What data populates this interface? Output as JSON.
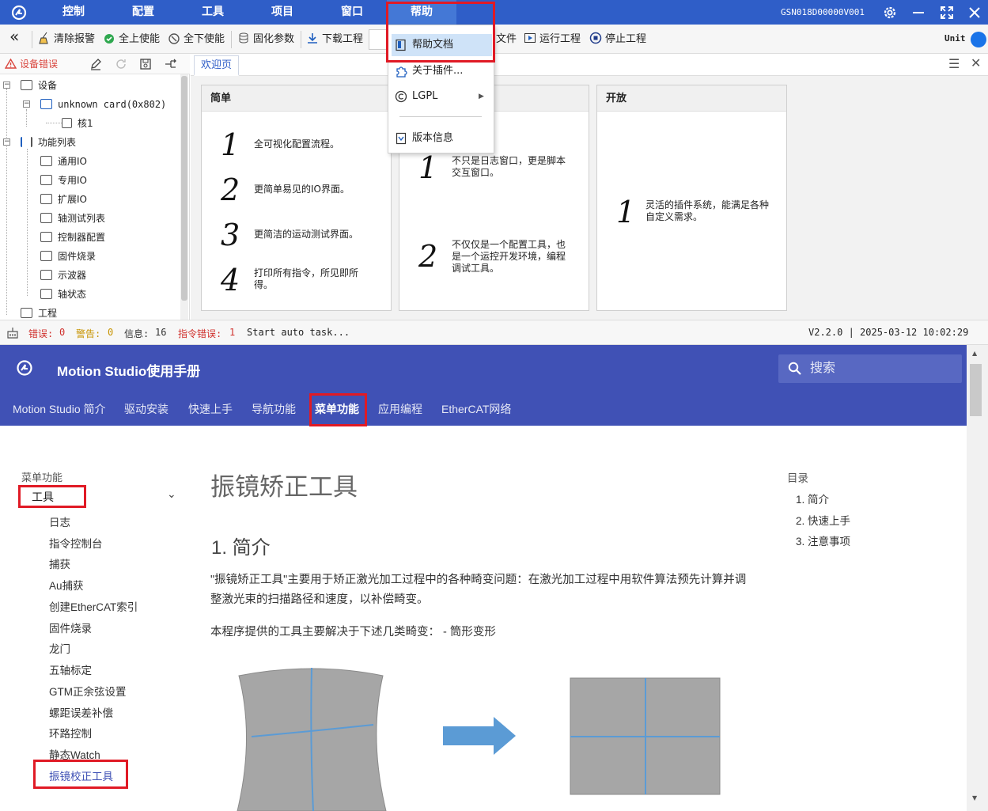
{
  "menubar": {
    "items": [
      "控制",
      "配置",
      "工具",
      "项目",
      "窗口",
      "帮助"
    ],
    "device_id": "GSN018D00000V001",
    "colors": {
      "bar": "#2f5ec8",
      "active": "#4478d6"
    }
  },
  "toolbar": {
    "items": [
      "清除报警",
      "全上使能",
      "全下使能",
      "固化参数",
      "下载工程",
      "文件",
      "运行工程",
      "停止工程"
    ],
    "unit_label": "Unit"
  },
  "help_menu": {
    "items": [
      "帮助文档",
      "关于插件...",
      "LGPL",
      "版本信息"
    ]
  },
  "left_panel": {
    "error_label": "设备错误",
    "tree": {
      "device": "设备",
      "card": "unknown card(0x802)",
      "core": "核1",
      "function_list": "功能列表",
      "functions": [
        "通用IO",
        "专用IO",
        "扩展IO",
        "轴测试列表",
        "控制器配置",
        "固件烧录",
        "示波器",
        "轴状态"
      ],
      "project": "工程"
    }
  },
  "welcome": {
    "tab": "欢迎页",
    "cards": [
      {
        "title": "简单",
        "items": [
          {
            "num": "1",
            "text": "全可视化配置流程。"
          },
          {
            "num": "2",
            "text": "更简单易见的IO界面。"
          },
          {
            "num": "3",
            "text": "更简洁的运动测试界面。"
          },
          {
            "num": "4",
            "text": "打印所有指令，所见即所得。"
          }
        ]
      },
      {
        "title": "",
        "items": [
          {
            "num": "1",
            "text": "不只是日志窗口，更是脚本交互窗口。"
          },
          {
            "num": "2",
            "text": "不仅仅是一个配置工具，也是一个运控开发环境，编程调试工具。"
          }
        ]
      },
      {
        "title": "开放",
        "items": [
          {
            "num": "1",
            "text": "灵活的插件系统，能满足各种自定义需求。"
          }
        ]
      }
    ]
  },
  "statusbar": {
    "error_label": "错误:",
    "error_count": "0",
    "warn_label": "警告:",
    "warn_count": "0",
    "info_label": "信息:",
    "info_count": "16",
    "cmd_err_label": "指令错误:",
    "cmd_err_count": "1",
    "message": "Start auto task...",
    "version": "V2.2.0 | 2025-03-12 10:02:29"
  },
  "doc": {
    "title": "Motion Studio使用手册",
    "search_placeholder": "搜索",
    "nav": [
      "Motion Studio 简介",
      "驱动安装",
      "快速上手",
      "导航功能",
      "菜单功能",
      "应用编程",
      "EtherCAT网络"
    ],
    "side_section": "菜单功能",
    "side_group": "工具",
    "side_items": [
      "日志",
      "指令控制台",
      "捕获",
      "Au捕获",
      "创建EtherCAT索引",
      "固件烧录",
      "龙门",
      "五轴标定",
      "GTM正余弦设置",
      "螺距误差补偿",
      "环路控制",
      "静态Watch",
      "振镜校正工具"
    ],
    "heading": "振镜矫正工具",
    "sub_heading": "1. 简介",
    "para1": "\"振镜矫正工具\"主要用于矫正激光加工过程中的各种畸变问题：在激光加工过程中用软件算法预先计算并调整激光束的扫描路径和速度，以补偿畸变。",
    "para2": "本程序提供的工具主要解决于下述几类畸变：  - 筒形变形",
    "toc_title": "目录",
    "toc": [
      "1. 简介",
      "2. 快速上手",
      "3. 注意事项"
    ],
    "colors": {
      "header": "#4051b5",
      "link_active": "#3f51b5",
      "highlight": "#e01a25"
    }
  }
}
